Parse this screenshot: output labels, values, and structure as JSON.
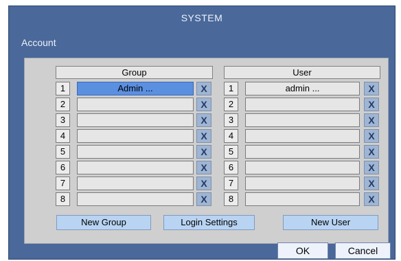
{
  "window": {
    "title": "SYSTEM"
  },
  "section": {
    "label": "Account"
  },
  "group": {
    "header": "Group",
    "rows": [
      {
        "num": "1",
        "name": "Admin ...",
        "delete": "X"
      },
      {
        "num": "2",
        "name": "",
        "delete": "X"
      },
      {
        "num": "3",
        "name": "",
        "delete": "X"
      },
      {
        "num": "4",
        "name": "",
        "delete": "X"
      },
      {
        "num": "5",
        "name": "",
        "delete": "X"
      },
      {
        "num": "6",
        "name": "",
        "delete": "X"
      },
      {
        "num": "7",
        "name": "",
        "delete": "X"
      },
      {
        "num": "8",
        "name": "",
        "delete": "X"
      }
    ]
  },
  "user": {
    "header": "User",
    "rows": [
      {
        "num": "1",
        "name": "admin ...",
        "delete": "X"
      },
      {
        "num": "2",
        "name": "",
        "delete": "X"
      },
      {
        "num": "3",
        "name": "",
        "delete": "X"
      },
      {
        "num": "4",
        "name": "",
        "delete": "X"
      },
      {
        "num": "5",
        "name": "",
        "delete": "X"
      },
      {
        "num": "6",
        "name": "",
        "delete": "X"
      },
      {
        "num": "7",
        "name": "",
        "delete": "X"
      },
      {
        "num": "8",
        "name": "",
        "delete": "X"
      }
    ]
  },
  "actions": {
    "new_group": "New Group",
    "login_settings": "Login Settings",
    "new_user": "New User"
  },
  "footer": {
    "ok": "OK",
    "cancel": "Cancel"
  },
  "colors": {
    "window_bg": "#4a6899",
    "panel_bg": "#cfcfcf",
    "selected_cell": "#5b8fe0",
    "action_button": "#b8d4f2"
  }
}
